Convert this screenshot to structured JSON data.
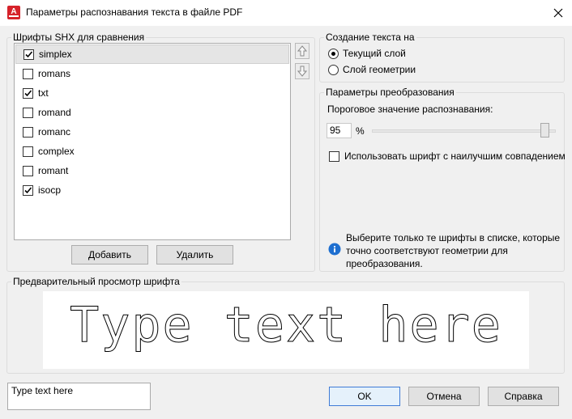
{
  "window": {
    "title": "Параметры распознавания текста в файле PDF",
    "app_icon_letter": "A",
    "close_icon": "close-icon"
  },
  "shx_fonts": {
    "group_label": "Шрифты SHX для сравнения",
    "items": [
      {
        "label": "simplex",
        "checked": true,
        "selected": true
      },
      {
        "label": "romans",
        "checked": false
      },
      {
        "label": "txt",
        "checked": true
      },
      {
        "label": "romand",
        "checked": false
      },
      {
        "label": "romanc",
        "checked": false
      },
      {
        "label": "complex",
        "checked": false
      },
      {
        "label": "romant",
        "checked": false
      },
      {
        "label": "isocp",
        "checked": true
      }
    ],
    "move_up_icon": "arrow-up-icon",
    "move_down_icon": "arrow-down-icon",
    "add_label": "Добавить",
    "remove_label": "Удалить"
  },
  "text_creation": {
    "group_label": "Создание текста на",
    "options": [
      {
        "label": "Текущий слой",
        "selected": true
      },
      {
        "label": "Слой геометрии",
        "selected": false
      }
    ]
  },
  "conversion": {
    "group_label": "Параметры преобразования",
    "threshold_label": "Пороговое значение распознавания:",
    "threshold_value": "95",
    "threshold_unit": "%",
    "threshold_level_percent": 95,
    "best_match_label": "Использовать шрифт с наилучшим совпадением",
    "best_match_checked": false,
    "info_icon": "info-icon",
    "info_text": "Выберите только те шрифты в списке, которые точно соответствуют геометрии для преобразования."
  },
  "preview": {
    "group_label": "Предварительный просмотр шрифта",
    "preview_text": "Type text here"
  },
  "footer": {
    "sample_text": "Type text here",
    "ok_label": "OK",
    "cancel_label": "Отмена",
    "help_label": "Справка"
  }
}
